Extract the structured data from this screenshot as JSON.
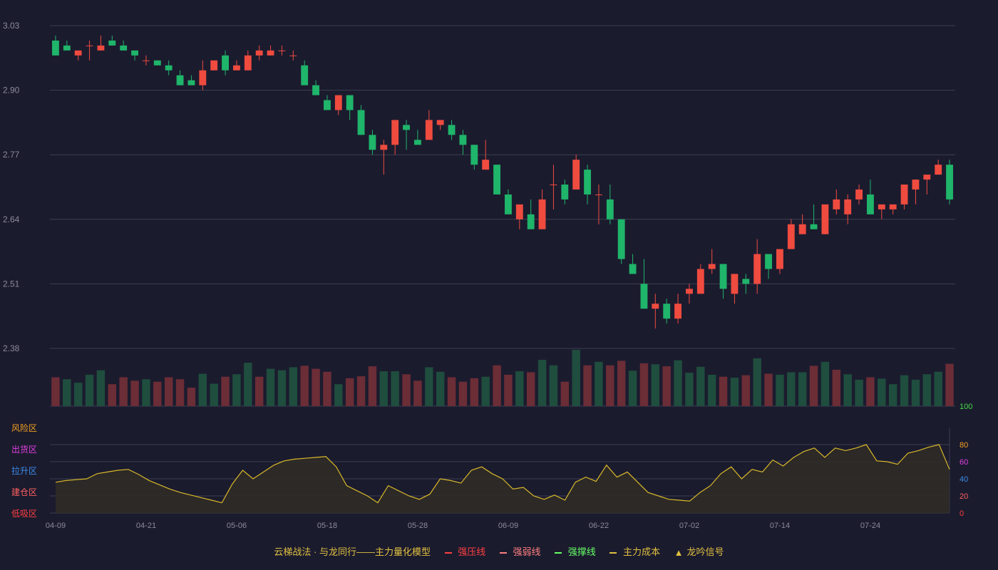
{
  "chart_data": {
    "type": "candlestick",
    "x_ticks": [
      "04-09",
      "04-21",
      "05-06",
      "05-18",
      "05-28",
      "06-09",
      "06-22",
      "07-02",
      "07-14",
      "07-24"
    ],
    "price_axis": {
      "ticks": [
        "3.03",
        "2.90",
        "2.77",
        "2.64",
        "2.51",
        "2.38"
      ],
      "ylim": [
        2.38,
        3.03
      ]
    },
    "ohlc": [
      [
        3.0,
        3.01,
        2.97,
        2.97
      ],
      [
        2.99,
        3.0,
        2.98,
        2.98
      ],
      [
        2.97,
        2.98,
        2.96,
        2.98
      ],
      [
        2.99,
        3.0,
        2.96,
        2.99
      ],
      [
        2.98,
        3.01,
        2.98,
        2.99
      ],
      [
        3.0,
        3.01,
        2.99,
        2.99
      ],
      [
        2.99,
        3.0,
        2.98,
        2.98
      ],
      [
        2.98,
        2.98,
        2.96,
        2.97
      ],
      [
        2.96,
        2.97,
        2.95,
        2.96
      ],
      [
        2.96,
        2.96,
        2.95,
        2.95
      ],
      [
        2.95,
        2.96,
        2.93,
        2.94
      ],
      [
        2.93,
        2.94,
        2.91,
        2.91
      ],
      [
        2.92,
        2.93,
        2.91,
        2.91
      ],
      [
        2.91,
        2.96,
        2.9,
        2.94
      ],
      [
        2.94,
        2.96,
        2.94,
        2.96
      ],
      [
        2.97,
        2.98,
        2.93,
        2.94
      ],
      [
        2.94,
        2.96,
        2.94,
        2.95
      ],
      [
        2.94,
        2.98,
        2.94,
        2.97
      ],
      [
        2.97,
        2.99,
        2.96,
        2.98
      ],
      [
        2.97,
        2.99,
        2.97,
        2.98
      ],
      [
        2.98,
        2.99,
        2.97,
        2.98
      ],
      [
        2.97,
        2.98,
        2.96,
        2.97
      ],
      [
        2.95,
        2.96,
        2.91,
        2.91
      ],
      [
        2.91,
        2.92,
        2.89,
        2.89
      ],
      [
        2.88,
        2.89,
        2.86,
        2.86
      ],
      [
        2.86,
        2.89,
        2.85,
        2.89
      ],
      [
        2.89,
        2.89,
        2.84,
        2.86
      ],
      [
        2.86,
        2.87,
        2.81,
        2.81
      ],
      [
        2.81,
        2.82,
        2.77,
        2.78
      ],
      [
        2.78,
        2.8,
        2.73,
        2.79
      ],
      [
        2.79,
        2.84,
        2.77,
        2.84
      ],
      [
        2.83,
        2.84,
        2.78,
        2.82
      ],
      [
        2.8,
        2.82,
        2.79,
        2.79
      ],
      [
        2.8,
        2.86,
        2.8,
        2.84
      ],
      [
        2.83,
        2.84,
        2.82,
        2.84
      ],
      [
        2.83,
        2.84,
        2.8,
        2.81
      ],
      [
        2.81,
        2.82,
        2.77,
        2.79
      ],
      [
        2.79,
        2.79,
        2.74,
        2.75
      ],
      [
        2.74,
        2.8,
        2.74,
        2.76
      ],
      [
        2.75,
        2.75,
        2.69,
        2.69
      ],
      [
        2.69,
        2.7,
        2.65,
        2.65
      ],
      [
        2.64,
        2.67,
        2.62,
        2.67
      ],
      [
        2.65,
        2.68,
        2.62,
        2.62
      ],
      [
        2.62,
        2.7,
        2.62,
        2.68
      ],
      [
        2.71,
        2.75,
        2.66,
        2.71
      ],
      [
        2.71,
        2.72,
        2.67,
        2.68
      ],
      [
        2.7,
        2.77,
        2.7,
        2.76
      ],
      [
        2.74,
        2.75,
        2.67,
        2.69
      ],
      [
        2.69,
        2.71,
        2.63,
        2.69
      ],
      [
        2.68,
        2.71,
        2.63,
        2.64
      ],
      [
        2.64,
        2.64,
        2.55,
        2.56
      ],
      [
        2.55,
        2.57,
        2.53,
        2.53
      ],
      [
        2.51,
        2.56,
        2.46,
        2.46
      ],
      [
        2.46,
        2.49,
        2.42,
        2.47
      ],
      [
        2.47,
        2.48,
        2.43,
        2.44
      ],
      [
        2.44,
        2.49,
        2.43,
        2.47
      ],
      [
        2.49,
        2.51,
        2.47,
        2.5
      ],
      [
        2.49,
        2.55,
        2.49,
        2.54
      ],
      [
        2.54,
        2.58,
        2.53,
        2.55
      ],
      [
        2.55,
        2.55,
        2.48,
        2.5
      ],
      [
        2.49,
        2.53,
        2.47,
        2.53
      ],
      [
        2.52,
        2.53,
        2.49,
        2.51
      ],
      [
        2.51,
        2.6,
        2.49,
        2.57
      ],
      [
        2.57,
        2.57,
        2.52,
        2.54
      ],
      [
        2.54,
        2.58,
        2.53,
        2.58
      ],
      [
        2.58,
        2.64,
        2.58,
        2.63
      ],
      [
        2.61,
        2.65,
        2.61,
        2.63
      ],
      [
        2.63,
        2.67,
        2.62,
        2.62
      ],
      [
        2.61,
        2.67,
        2.61,
        2.67
      ],
      [
        2.66,
        2.7,
        2.65,
        2.68
      ],
      [
        2.65,
        2.69,
        2.63,
        2.68
      ],
      [
        2.68,
        2.71,
        2.67,
        2.7
      ],
      [
        2.69,
        2.72,
        2.65,
        2.65
      ],
      [
        2.66,
        2.67,
        2.64,
        2.67
      ],
      [
        2.66,
        2.67,
        2.65,
        2.67
      ],
      [
        2.67,
        2.7,
        2.66,
        2.71
      ],
      [
        2.7,
        2.72,
        2.67,
        2.72
      ],
      [
        2.72,
        2.73,
        2.69,
        2.73
      ],
      [
        2.73,
        2.76,
        2.73,
        2.75
      ],
      [
        2.75,
        2.76,
        2.67,
        2.68
      ]
    ],
    "volume": [
      [
        1,
        58
      ],
      [
        0,
        54
      ],
      [
        0,
        47
      ],
      [
        0,
        63
      ],
      [
        0,
        72
      ],
      [
        1,
        44
      ],
      [
        1,
        58
      ],
      [
        1,
        51
      ],
      [
        0,
        54
      ],
      [
        1,
        49
      ],
      [
        1,
        58
      ],
      [
        1,
        54
      ],
      [
        1,
        37
      ],
      [
        0,
        65
      ],
      [
        0,
        45
      ],
      [
        1,
        59
      ],
      [
        0,
        64
      ],
      [
        0,
        87
      ],
      [
        1,
        59
      ],
      [
        0,
        75
      ],
      [
        0,
        72
      ],
      [
        0,
        78
      ],
      [
        1,
        81
      ],
      [
        1,
        75
      ],
      [
        1,
        69
      ],
      [
        0,
        44
      ],
      [
        1,
        56
      ],
      [
        1,
        60
      ],
      [
        1,
        80
      ],
      [
        0,
        70
      ],
      [
        0,
        70
      ],
      [
        1,
        64
      ],
      [
        1,
        51
      ],
      [
        0,
        78
      ],
      [
        0,
        69
      ],
      [
        1,
        58
      ],
      [
        1,
        49
      ],
      [
        1,
        56
      ],
      [
        0,
        59
      ],
      [
        1,
        82
      ],
      [
        1,
        63
      ],
      [
        0,
        70
      ],
      [
        1,
        68
      ],
      [
        0,
        93
      ],
      [
        0,
        82
      ],
      [
        1,
        49
      ],
      [
        0,
        113
      ],
      [
        1,
        82
      ],
      [
        0,
        89
      ],
      [
        1,
        82
      ],
      [
        1,
        91
      ],
      [
        0,
        71
      ],
      [
        1,
        86
      ],
      [
        0,
        84
      ],
      [
        1,
        80
      ],
      [
        0,
        92
      ],
      [
        0,
        67
      ],
      [
        0,
        79
      ],
      [
        0,
        63
      ],
      [
        1,
        59
      ],
      [
        0,
        57
      ],
      [
        1,
        62
      ],
      [
        0,
        96
      ],
      [
        1,
        65
      ],
      [
        0,
        63
      ],
      [
        0,
        68
      ],
      [
        0,
        68
      ],
      [
        1,
        81
      ],
      [
        0,
        89
      ],
      [
        1,
        73
      ],
      [
        0,
        64
      ],
      [
        0,
        53
      ],
      [
        1,
        58
      ],
      [
        0,
        55
      ],
      [
        0,
        44
      ],
      [
        0,
        62
      ],
      [
        0,
        53
      ],
      [
        0,
        64
      ],
      [
        0,
        69
      ],
      [
        1,
        85
      ]
    ],
    "indicator": {
      "axis_ticks": [
        "100",
        "80",
        "60",
        "40",
        "20",
        "0"
      ],
      "ylim": [
        0,
        100
      ],
      "zones": [
        "风险区",
        "出货区",
        "拉升区",
        "建仓区",
        "低吸区"
      ],
      "values": [
        36,
        38,
        39,
        40,
        46,
        48,
        50,
        51,
        45,
        38,
        33,
        28,
        24,
        21,
        18,
        15,
        12,
        34,
        50,
        40,
        48,
        56,
        61,
        63,
        64,
        65,
        66,
        54,
        32,
        26,
        20,
        12,
        32,
        26,
        20,
        16,
        22,
        40,
        38,
        35,
        50,
        54,
        46,
        40,
        28,
        30,
        20,
        16,
        21,
        15,
        36,
        42,
        37,
        56,
        42,
        48,
        36,
        24,
        20,
        16,
        15,
        14,
        24,
        32,
        46,
        54,
        40,
        51,
        48,
        62,
        55,
        65,
        72,
        76,
        65,
        76,
        73,
        76,
        80,
        61,
        60,
        57,
        70,
        73,
        77,
        80,
        51
      ]
    },
    "legend": [
      {
        "label": "云梯战法 · 与龙同行——主力量化模型",
        "color": "#e0c040"
      },
      {
        "label": "强压线",
        "color": "#ff4040",
        "style": "solid"
      },
      {
        "label": "强弱线",
        "color": "#ff8080",
        "style": "dash"
      },
      {
        "label": "强撑线",
        "color": "#66ff66",
        "style": "solid"
      },
      {
        "label": "主力成本",
        "color": "#e0c040",
        "style": "dash"
      },
      {
        "label": "龙吟信号",
        "color": "#e0c040",
        "style": "triangle",
        "mark": "▲"
      }
    ],
    "colors": {
      "up": "#ef4b3f",
      "down": "#1fb56a",
      "vol_up": "#6b2d36",
      "vol_down": "#1f4d3e",
      "grid": "#3e3e52",
      "axis_text": "#8a8a9a",
      "indicator_line": "#d8b82a",
      "indicator_fill": "#2f2b26",
      "axis_100": "#44dd44",
      "axis_80": "#f0a020",
      "axis_60": "#e040e0",
      "axis_40": "#3a8ce8",
      "axis_20": "#ff6060",
      "axis_0": "#ff4040",
      "zone_risk": "#f0a020",
      "zone_ship": "#e040e0",
      "zone_rise": "#3a8ce8",
      "zone_build": "#ff6060",
      "zone_low": "#ff4040"
    }
  }
}
